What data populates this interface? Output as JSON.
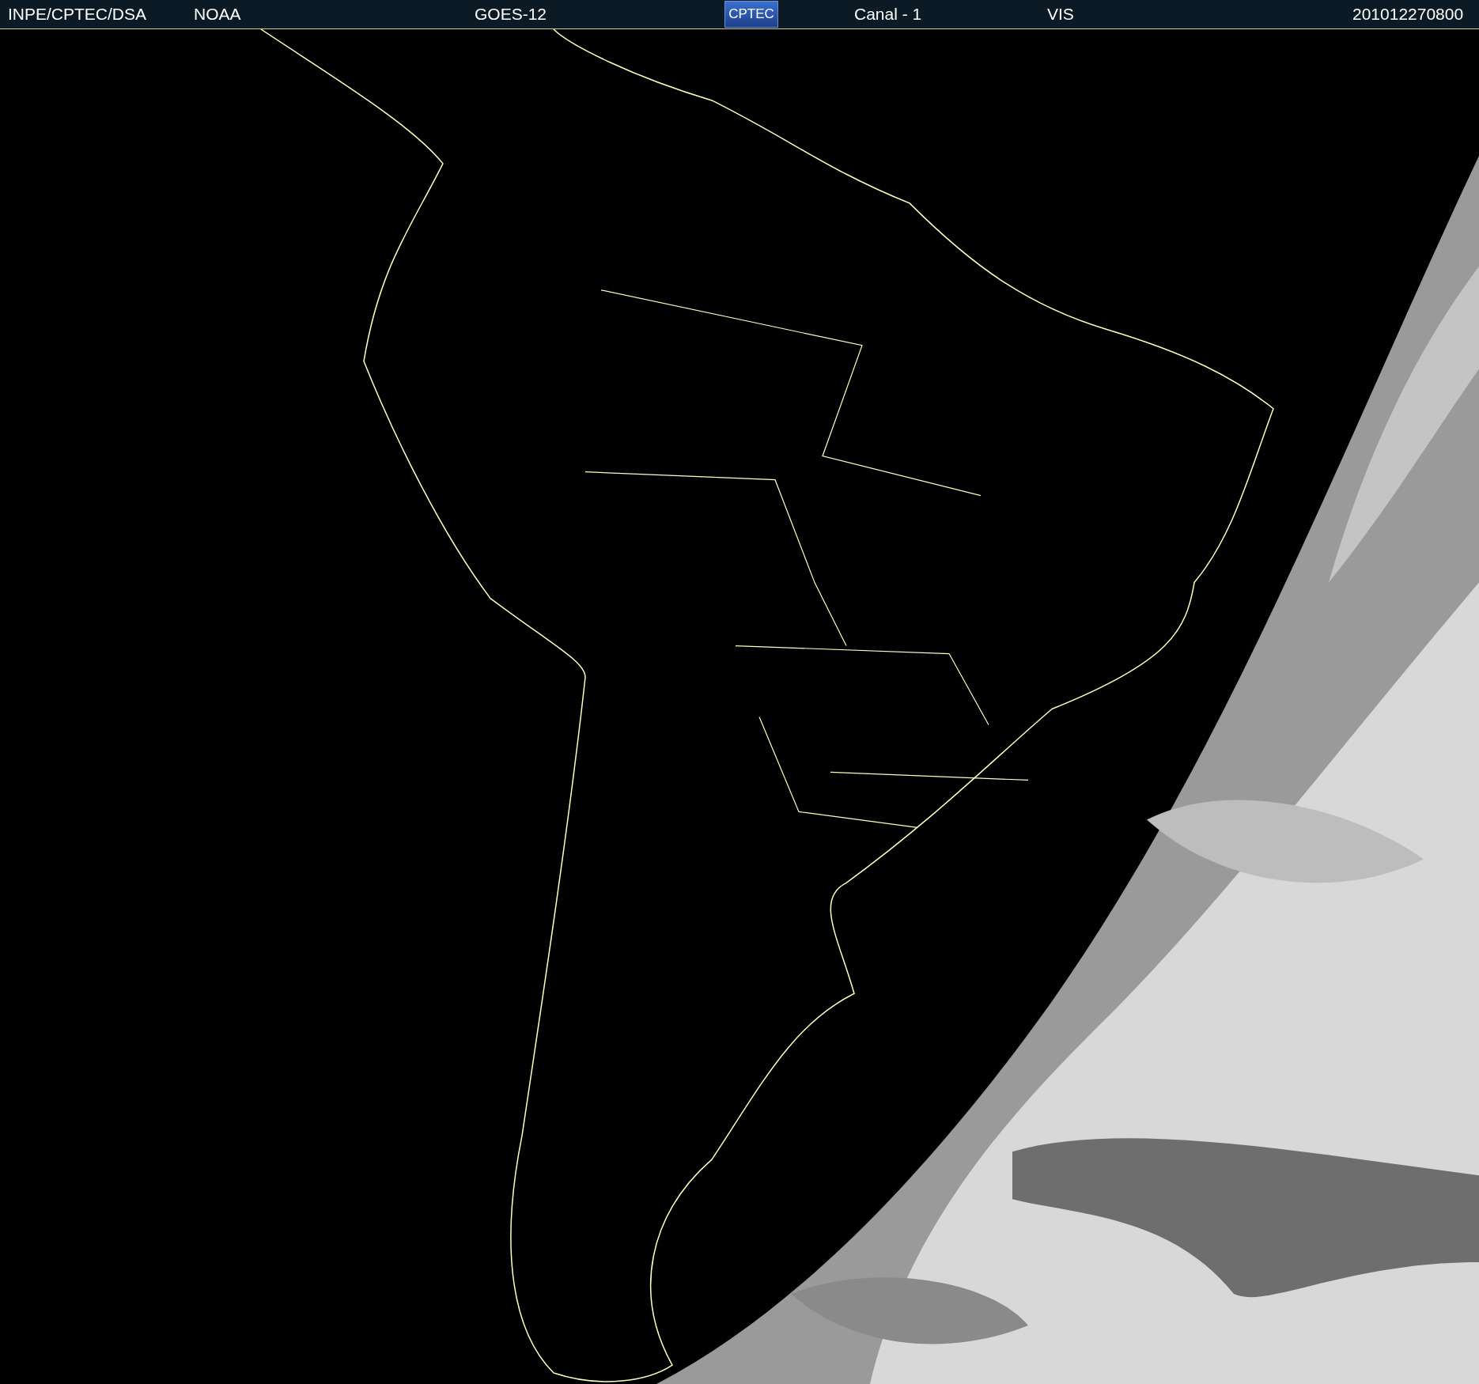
{
  "header": {
    "source": "INPE/CPTEC/DSA",
    "agency": "NOAA",
    "satellite": "GOES-12",
    "logo": "CPTEC",
    "channel": "Canal - 1",
    "band": "VIS",
    "timestamp": "201012270800"
  }
}
